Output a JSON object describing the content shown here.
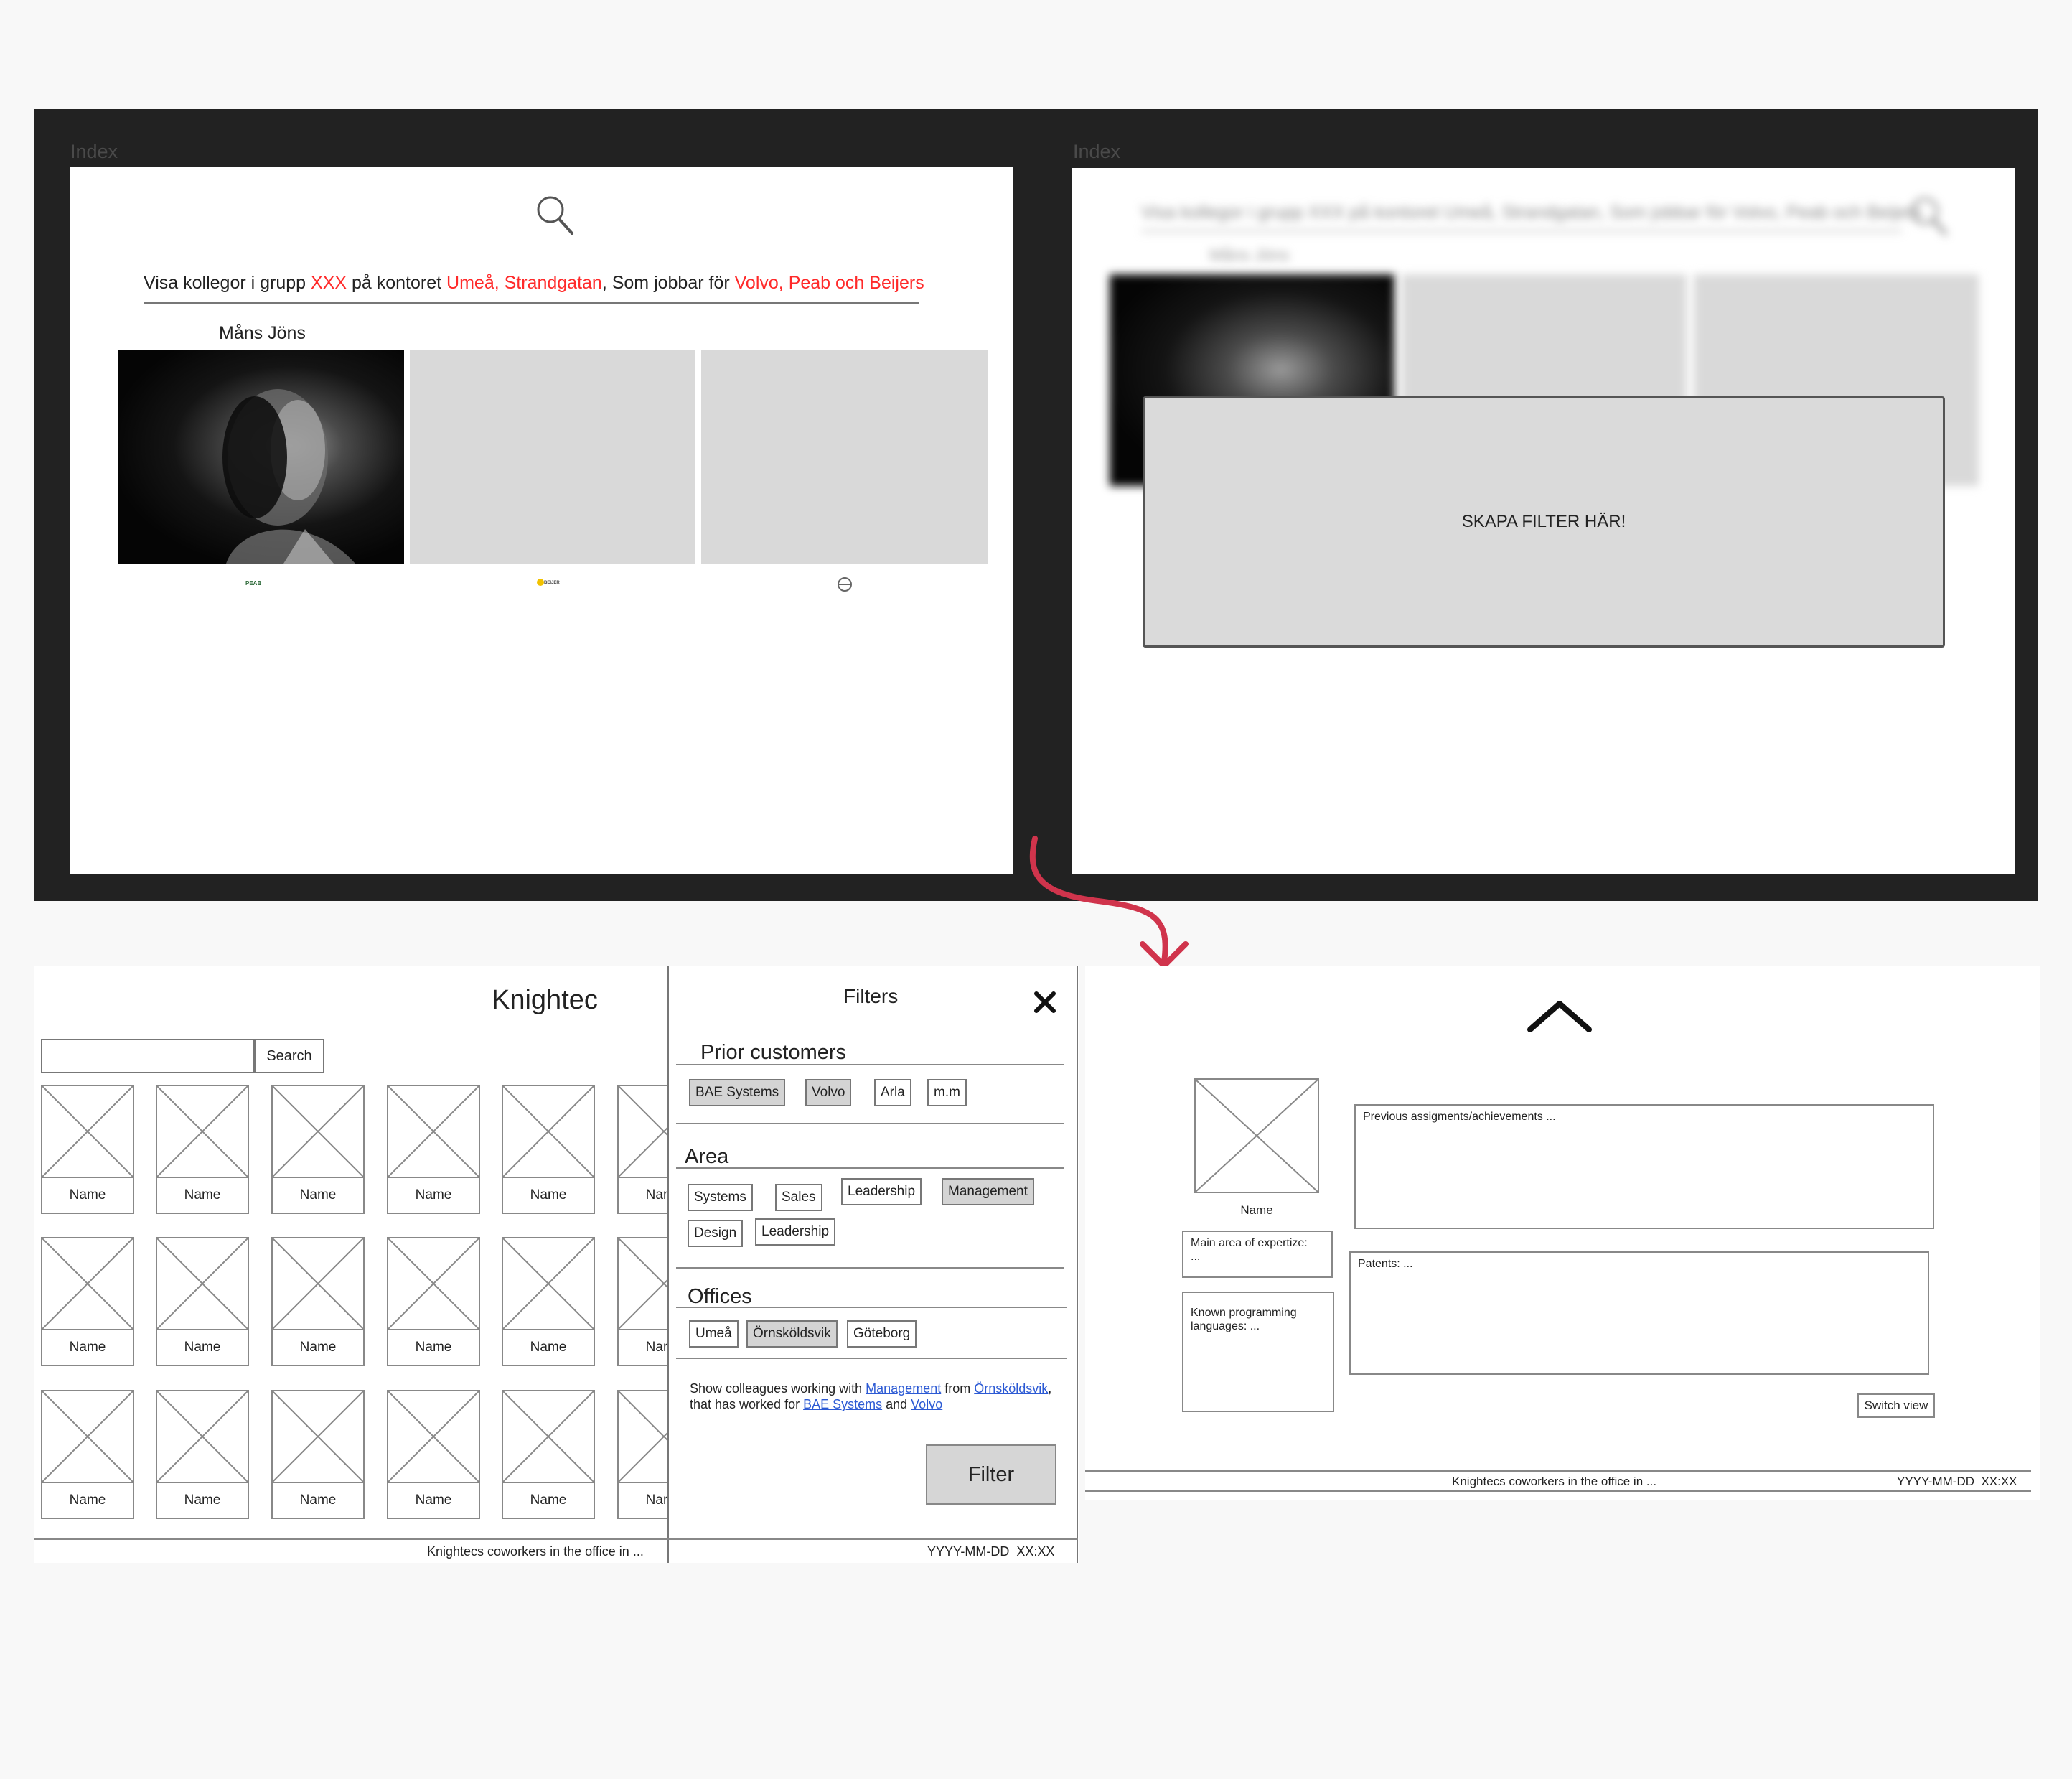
{
  "frames": {
    "frame1": {
      "label": "Index",
      "sentence": {
        "p1": "Visa kollegor i grupp ",
        "group": "XXX",
        "p2": " på kontoret ",
        "office": "Umeå, Strandgatan",
        "p3": ", Som jobbar för ",
        "customers": "Volvo, Peab och Beijers"
      },
      "person_name": "Måns Jöns",
      "logos": [
        "PEAB",
        "BEIJER"
      ]
    },
    "frame2": {
      "label": "Index",
      "sentence": "Visa kollegor i grupp XXX på kontoret Umeå, Strandgatan, Som jobbar för Volvo, Peab och Beijers",
      "person_name": "Måns Jöns",
      "modal_text": "SKAPA FILTER HÄR!"
    }
  },
  "grid_view": {
    "title": "Knightec",
    "search_button": "Search",
    "search_value": "",
    "tile_label": "Name",
    "footer_left": "Knightecs coworkers in the office in ...",
    "footer_right": "YYYY-MM-DD  XX:XX"
  },
  "filters": {
    "title": "Filters",
    "close_icon": "close-icon",
    "prior_customers": {
      "title": "Prior customers",
      "tags": [
        {
          "label": "BAE Systems",
          "selected": true
        },
        {
          "label": "Volvo",
          "selected": true
        },
        {
          "label": "Arla",
          "selected": false
        },
        {
          "label": "m.m",
          "selected": false
        }
      ]
    },
    "area": {
      "title": "Area",
      "tags": [
        {
          "label": "Systems",
          "selected": false
        },
        {
          "label": "Sales",
          "selected": false
        },
        {
          "label": "Leadership",
          "selected": false
        },
        {
          "label": "Management",
          "selected": true
        },
        {
          "label": "Design",
          "selected": false
        },
        {
          "label": "Leadership",
          "selected": false
        }
      ]
    },
    "offices": {
      "title": "Offices",
      "tags": [
        {
          "label": "Umeå",
          "selected": false
        },
        {
          "label": "Örnsköldsvik",
          "selected": true
        },
        {
          "label": "Göteborg",
          "selected": false
        }
      ]
    },
    "summary": {
      "t1": "Show colleagues working with ",
      "l1": "Management",
      "t2": " from ",
      "l2": "Örnsköldsvik",
      "t3": ", that has worked for ",
      "l3": "BAE Systems",
      "t4": " and ",
      "l4": "Volvo"
    },
    "filter_button": "Filter"
  },
  "profile_view": {
    "collapse_icon": "chevron-up-icon",
    "name": "Name",
    "main_area": "Main area of expertize:\n...",
    "languages": "Known programming languages: ...",
    "previous": "Previous assigments/achievements ...",
    "patents": "Patents: ...",
    "switch_button": "Switch view",
    "footer_left": "Knightecs coworkers in the office in ...",
    "footer_right": "YYYY-MM-DD  XX:XX"
  },
  "colors": {
    "canvas": "#222222",
    "highlight_red": "#ff2a2a",
    "link_blue": "#2c5ad4",
    "arrow": "#d0344c",
    "selected_tag": "#d4d4d4"
  }
}
